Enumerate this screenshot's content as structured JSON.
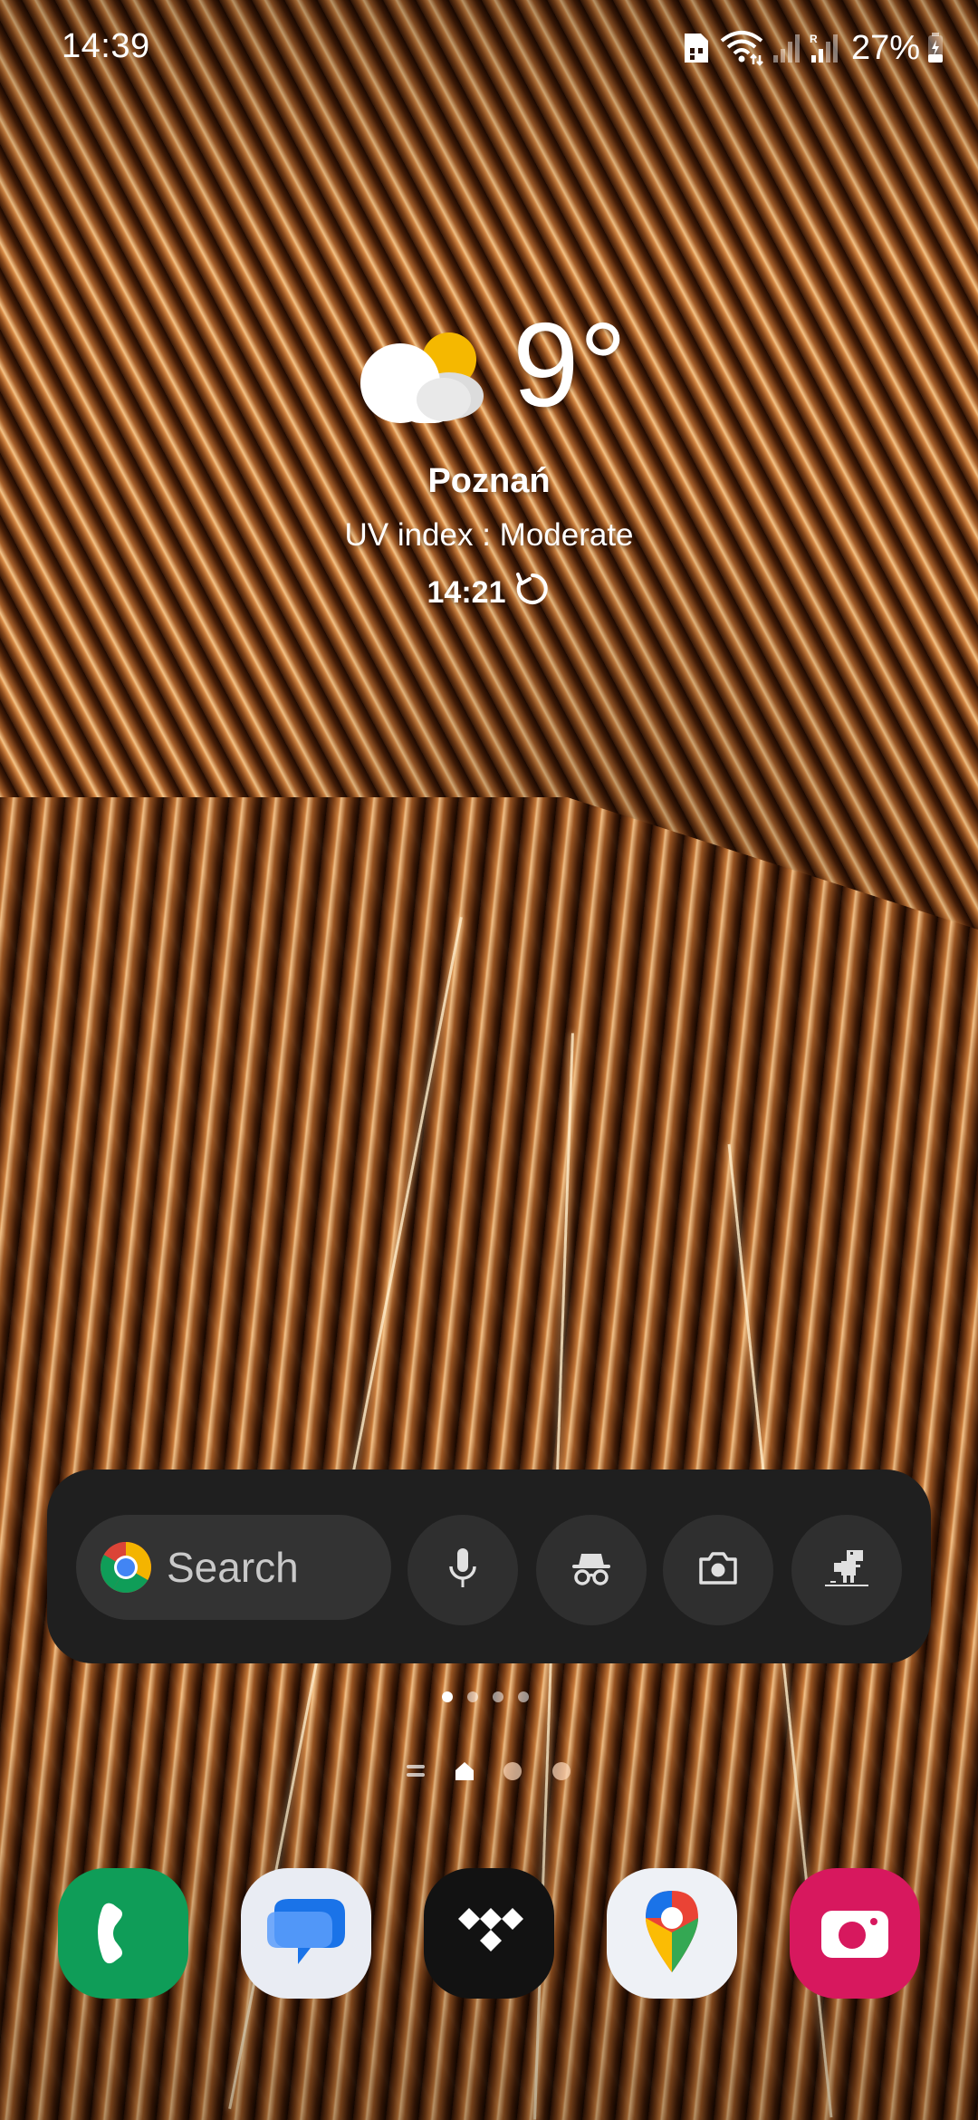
{
  "status_bar": {
    "time": "14:39",
    "battery": "27%",
    "icons": [
      "sim-card-icon",
      "wifi-icon",
      "signal-icon",
      "signal-roaming-icon",
      "battery-charging-icon"
    ]
  },
  "weather": {
    "temperature": "9°",
    "condition_icon": "partly-cloudy-icon",
    "city": "Poznań",
    "uv": "UV index : Moderate",
    "updated": "14:21"
  },
  "search_widget": {
    "placeholder": "Search",
    "buttons": [
      "mic-icon",
      "incognito-icon",
      "lens-camera-icon",
      "dino-icon"
    ]
  },
  "pages": {
    "count": 4,
    "active": 0
  },
  "dock": {
    "apps": [
      "Phone",
      "Messages",
      "TIDAL",
      "Maps",
      "Camera"
    ]
  },
  "colors": {
    "widget_bg": "#1f1f1f",
    "pill_bg": "#333333",
    "phone_green": "#0f9d58",
    "messages_blue": "#1a73e8",
    "camera_pink": "#d7185e"
  }
}
